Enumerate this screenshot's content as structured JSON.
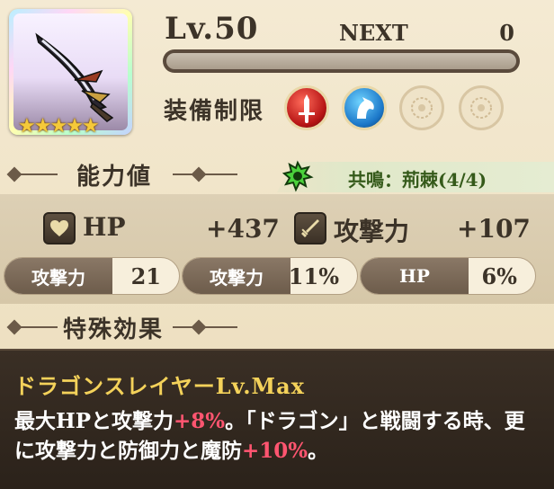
{
  "weapon": {
    "icon": "scythe-blade-icon",
    "rarity_stars": "★★★★★"
  },
  "level": {
    "label": "Lv.50",
    "next_label": "NEXT",
    "next_value": "0",
    "exp_progress": 0
  },
  "equip": {
    "label": "装備制限",
    "icons": [
      "sword-class-icon",
      "cavalry-horse-icon",
      "empty-slot-icon",
      "empty-slot-icon"
    ]
  },
  "abilities": {
    "section_title": "能力値",
    "resonance_text": "共鳴：荊棘(4/4)",
    "hp_label": "HP",
    "hp_value": "+437",
    "atk_label": "攻撃力",
    "atk_value": "+107",
    "bonuses": [
      {
        "label": "攻撃力",
        "value": "21"
      },
      {
        "label": "攻撃力",
        "value": "11%"
      },
      {
        "label": "HP",
        "value": "6%"
      }
    ]
  },
  "special": {
    "section_title": "特殊効果",
    "name": "ドラゴンスレイヤーLv.Max",
    "desc_1": "最大HPと攻撃力",
    "desc_hl1": "+8%",
    "desc_2": "。「ドラゴン」と戦闘する時、更に攻撃力と防御力と魔防",
    "desc_hl2": "+10%",
    "desc_3": "。"
  },
  "colors": {
    "accent_gold": "#f4d25a",
    "highlight_red": "#ff5570",
    "resonance_green": "#355a1a"
  }
}
